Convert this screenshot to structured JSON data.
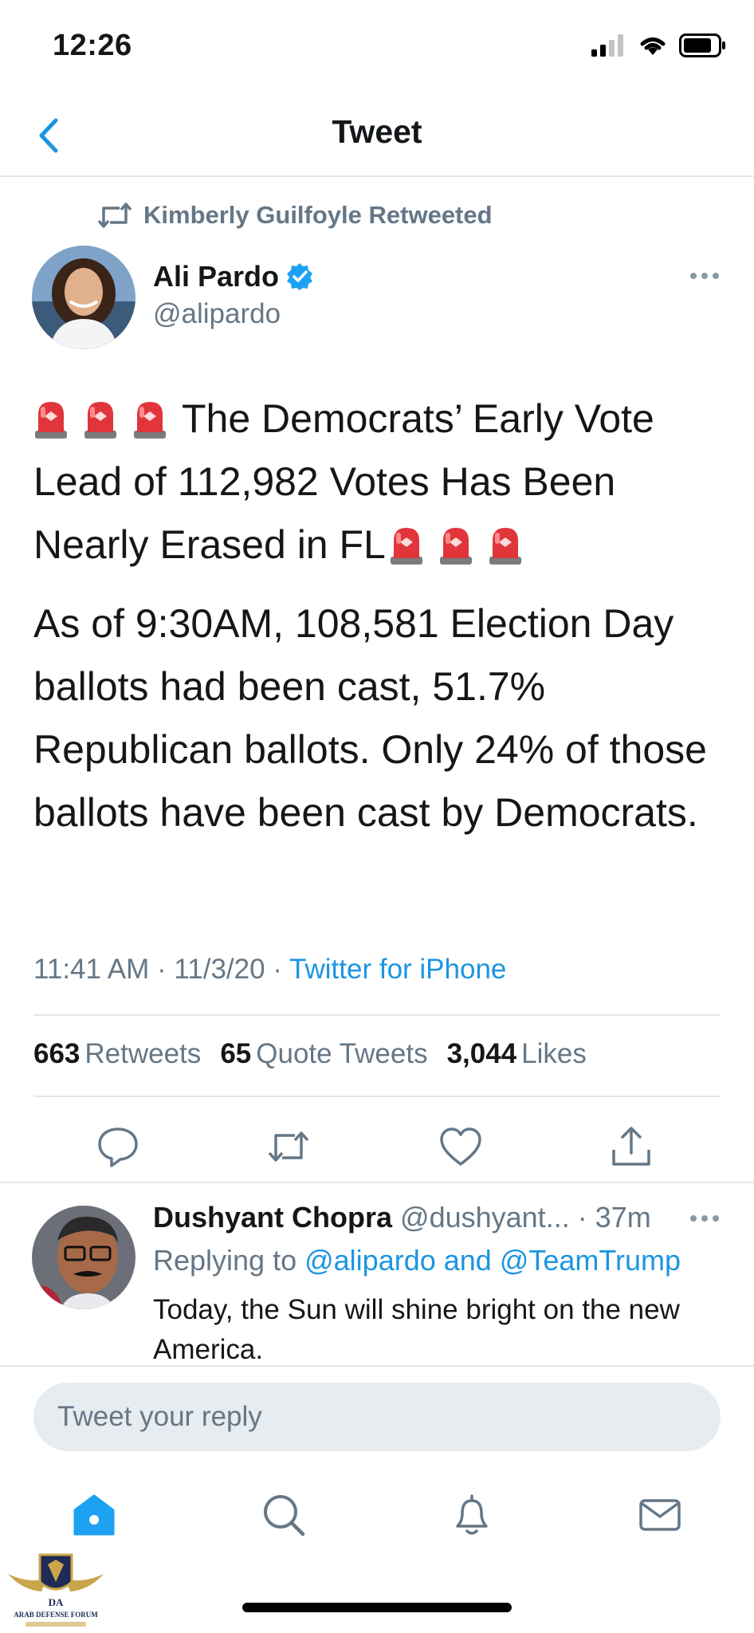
{
  "status_bar": {
    "time": "12:26"
  },
  "nav": {
    "title": "Tweet"
  },
  "retweet_context": {
    "text": "Kimberly Guilfoyle Retweeted"
  },
  "tweet": {
    "author_name": "Ali Pardo",
    "author_handle": "@alipardo",
    "verified": true,
    "paragraph_1": "The Democrats’ Early Vote Lead of 112,982 Votes Has Been Nearly Erased in FL",
    "paragraph_2": "As of 9:30AM, 108,581 Election Day ballots had been cast, 51.7% Republican ballots. Only 24% of those ballots have been cast by Democrats.",
    "timestamp": "11:41 AM · 11/3/20 · ",
    "source": "Twitter for iPhone"
  },
  "stats": {
    "retweets_count": "663",
    "retweets_label": "Retweets",
    "quotes_count": "65",
    "quotes_label": "Quote Tweets",
    "likes_count": "3,044",
    "likes_label": "Likes"
  },
  "reply": {
    "author_name": "Dushyant Chopra",
    "meta": " @dushyant... · 37m",
    "replying_prefix": "Replying to ",
    "mentions": "@alipardo and @TeamTrump",
    "text": "Today, the Sun will shine bright on the new America."
  },
  "compose": {
    "placeholder": "Tweet your reply"
  },
  "watermark": {
    "line1": "DA",
    "line2": "ARAB DEFENSE FORUM"
  },
  "colors": {
    "accent": "#1b95e0",
    "secondary_text": "#657786",
    "divider": "#e1e8ed"
  },
  "icons": [
    "back-chevron-icon",
    "retweet-icon",
    "verified-badge-icon",
    "more-icon",
    "reply-icon",
    "share-icon",
    "like-icon",
    "home-icon",
    "search-icon",
    "notifications-icon",
    "messages-icon",
    "siren-emoji"
  ]
}
